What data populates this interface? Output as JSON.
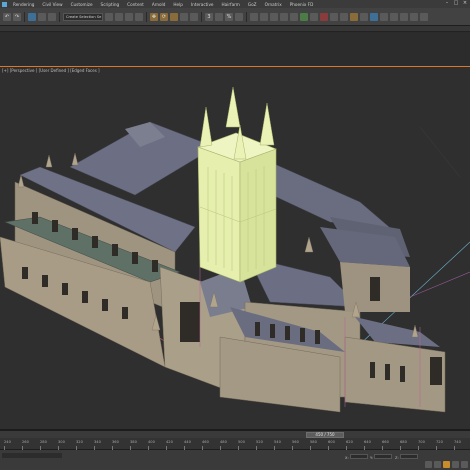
{
  "menubar": {
    "items": [
      "Rendering",
      "Civil View",
      "Customize",
      "Scripting",
      "Content",
      "Arnold",
      "Help",
      "Interactive",
      "Hairfarm",
      "GoZ",
      "Ornatrix",
      "Phoenix FD"
    ]
  },
  "toolbar": {
    "selection_set_placeholder": "Create Selection Se",
    "snap_label": "3",
    "percent_label": "%"
  },
  "viewport": {
    "label": "[+] [Perspective ] [User Defined ] [Edged Faces ]"
  },
  "timeline": {
    "frame_display": "450 / 750",
    "ticks": [
      "240",
      "260",
      "280",
      "300",
      "320",
      "340",
      "360",
      "380",
      "400",
      "420",
      "440",
      "460",
      "480",
      "500",
      "520",
      "540",
      "560",
      "580",
      "600",
      "620",
      "640",
      "660",
      "680",
      "700",
      "720",
      "740"
    ]
  },
  "status": {
    "x_label": "X:",
    "y_label": "Y:",
    "z_label": "Z:"
  },
  "colors": {
    "viewport_bg": "#2f2f2f",
    "active_border": "#d9772c",
    "selection_highlight": "#e7f0b0",
    "stone": "#a79b85",
    "roof": "#6e7289"
  }
}
